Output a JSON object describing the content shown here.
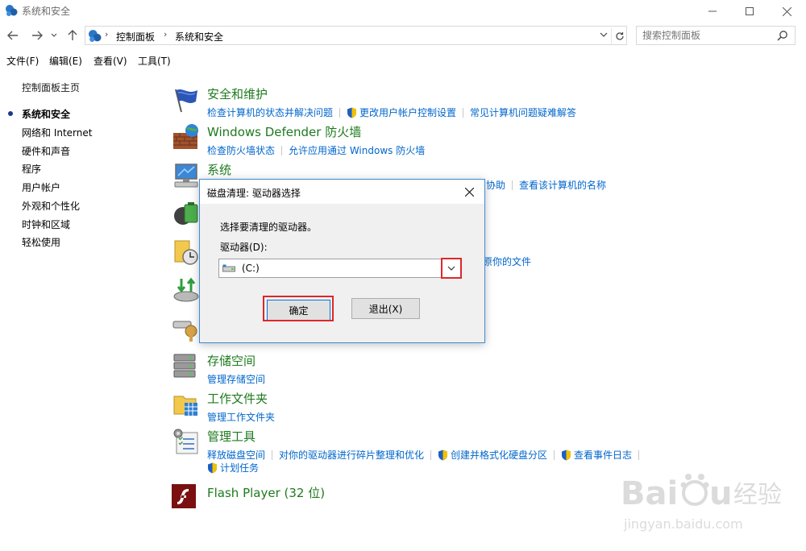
{
  "window": {
    "title": "系统和安全",
    "controls": [
      "minimize-icon",
      "maximize-icon",
      "close-icon"
    ]
  },
  "address": {
    "crumbs": [
      "控制面板",
      "系统和安全"
    ],
    "search_placeholder": "搜索控制面板"
  },
  "menu": [
    "文件(F)",
    "编辑(E)",
    "查看(V)",
    "工具(T)"
  ],
  "left_nav": {
    "home": "控制面板主页",
    "items": [
      "系统和安全",
      "网络和 Internet",
      "硬件和声音",
      "程序",
      "用户帐户",
      "外观和个性化",
      "时钟和区域",
      "轻松使用"
    ],
    "active_index": 0
  },
  "categories": [
    {
      "title": "安全和维护",
      "icon": "flag-icon",
      "links": [
        {
          "text": "检查计算机的状态并解决问题",
          "shield": false
        },
        {
          "text": "更改用户帐户控制设置",
          "shield": true
        },
        {
          "text": "常见计算机问题疑难解答",
          "shield": false
        }
      ]
    },
    {
      "title": "Windows Defender 防火墙",
      "icon": "firewall-icon",
      "links": [
        {
          "text": "检查防火墙状态",
          "shield": false
        },
        {
          "text": "允许应用通过 Windows 防火墙",
          "shield": false
        }
      ]
    },
    {
      "title": "系统",
      "icon": "computer-icon",
      "links_visible_right": [
        "协助",
        "查看该计算机的名称"
      ]
    },
    {
      "title": "",
      "icon": "power-icon"
    },
    {
      "title": "",
      "icon": "file-history-icon",
      "links_visible_right": [
        "原你的文件"
      ]
    },
    {
      "title": "",
      "icon": "backup-icon"
    },
    {
      "title": "",
      "icon": "bitlocker-icon"
    },
    {
      "title": "存储空间",
      "icon": "storage-icon",
      "links": [
        {
          "text": "管理存储空间",
          "shield": false
        }
      ]
    },
    {
      "title": "工作文件夹",
      "icon": "work-folders-icon",
      "links": [
        {
          "text": "管理工作文件夹",
          "shield": false
        }
      ]
    },
    {
      "title": "管理工具",
      "icon": "admin-tools-icon",
      "links": [
        {
          "text": "释放磁盘空间",
          "shield": false
        },
        {
          "text": "对你的驱动器进行碎片整理和优化",
          "shield": false
        },
        {
          "text": "创建并格式化硬盘分区",
          "shield": true
        },
        {
          "text": "查看事件日志",
          "shield": true
        }
      ],
      "links_line2": [
        {
          "text": "计划任务",
          "shield": true
        }
      ]
    },
    {
      "title": "Flash Player (32 位)",
      "icon": "flash-icon"
    }
  ],
  "dialog": {
    "title": "磁盘清理: 驱动器选择",
    "prompt": "选择要清理的驱动器。",
    "drive_label": "驱动器(D):",
    "drive_value": "(C:)",
    "ok_label": "确定",
    "exit_label": "退出(X)"
  },
  "colors": {
    "link": "#0066cc",
    "category_title": "#1e7a1e",
    "highlight": "#e0262a",
    "dialog_border": "#3c8cd8"
  }
}
